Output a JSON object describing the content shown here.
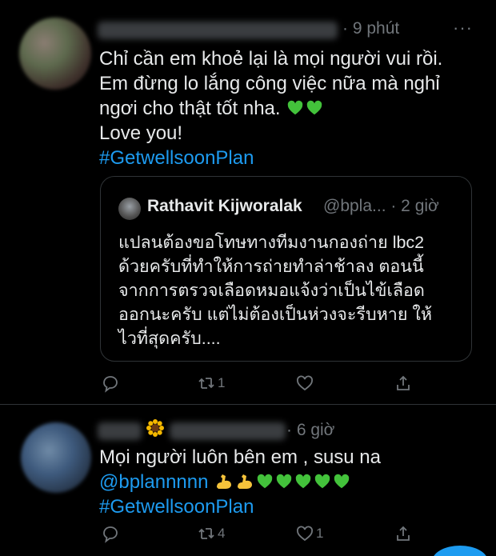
{
  "tweet1": {
    "time": "· 9 phút",
    "more_label": "···",
    "lines": [
      "Chỉ cần em khoẻ lại là mọi người vui rồi.",
      "Em đừng lo lắng công việc nữa mà nghỉ",
      "ngơi cho thật tốt nha.",
      "Love you!"
    ],
    "hashtag": "#GetwellsoonPlan",
    "quote": {
      "name": "Rathavit Kijworalak",
      "meta": "@bpla... · 2 giờ",
      "lines": [
        "แปลนต้องขอโทษทางทีมงานกองถ่าย lbc2",
        "ด้วยครับที่ทำให้การถ่ายทำล่าช้าลง ตอนนี้",
        "จากการตรวจเลือดหมอแจ้งว่าเป็นไข้เลือด",
        "ออกนะครับ แต่ไม่ต้องเป็นห่วงจะรีบหาย ให้",
        "ไวที่สุดครับ...."
      ]
    },
    "actions": {
      "reply": "",
      "retweet": "1",
      "like": ""
    }
  },
  "tweet2": {
    "time": "· 6 giờ",
    "line1": "Mọi người luôn bên em , susu na",
    "mention": "@bplannnnn",
    "hashtag": "#GetwellsoonPlan",
    "actions": {
      "reply": "",
      "retweet": "4",
      "like": "1"
    }
  },
  "colors": {
    "accent": "#1d9bf0",
    "muted": "#71767b",
    "text": "#e7e9ea",
    "heart_emoji": "#43c23b"
  },
  "icons": [
    "reply-icon",
    "retweet-icon",
    "like-icon",
    "share-icon",
    "green-heart-emoji",
    "flexed-biceps-emoji",
    "sunflower-emoji"
  ]
}
